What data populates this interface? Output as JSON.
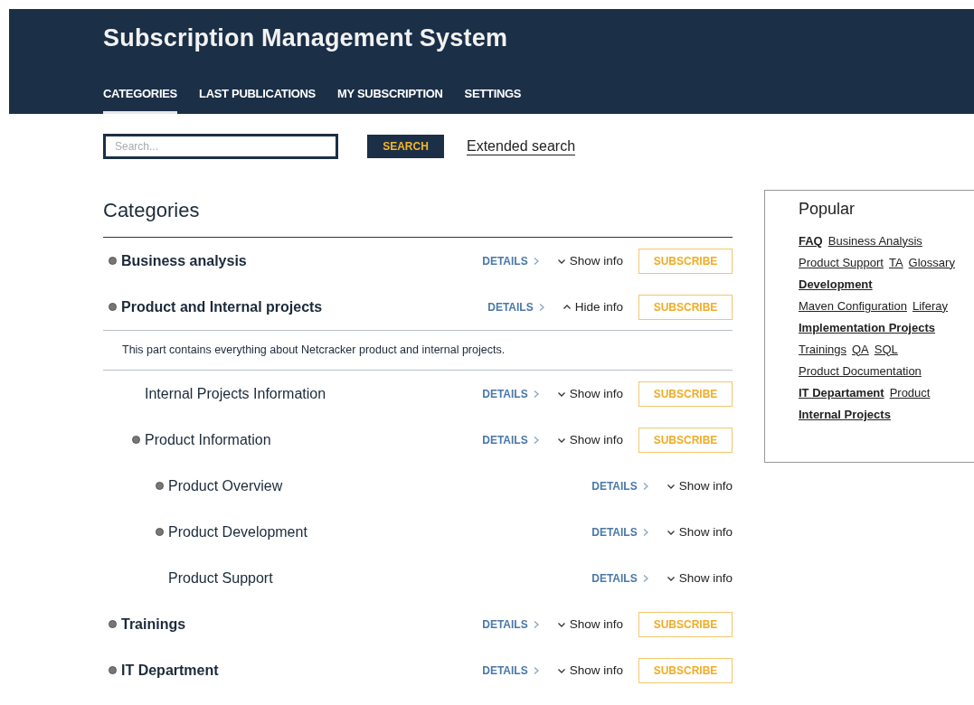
{
  "header": {
    "title": "Subscription Management System"
  },
  "nav": [
    {
      "label": "CATEGORIES",
      "selected": true
    },
    {
      "label": "LAST PUBLICATIONS",
      "selected": false
    },
    {
      "label": "MY SUBSCRIPTION",
      "selected": false
    },
    {
      "label": "SETTINGS",
      "selected": false
    }
  ],
  "search": {
    "placeholder": "Search...",
    "button": "SEARCH",
    "extended_link": "Extended search"
  },
  "categories": {
    "title": "Categories",
    "items": [
      {
        "name": "Business analysis",
        "has_subcategories": true,
        "details": "DETAILS",
        "toggle": "Show info",
        "expanded": false,
        "subscribe": "SUBSCRIBE"
      },
      {
        "name": "Product and Internal projects",
        "has_subcategories": true,
        "details": "DETAILS",
        "toggle": "Hide info",
        "expanded": true,
        "subscribe": "SUBSCRIBE",
        "description": "This part contains everything about Netcracker product and internal projects.",
        "children": [
          {
            "name": "Internal Projects Information",
            "has_subcategories": false,
            "details": "DETAILS",
            "toggle": "Show info",
            "expanded": false,
            "subscribe": "SUBSCRIBE"
          },
          {
            "name": "Product Information",
            "has_subcategories": true,
            "details": "DETAILS",
            "toggle": "Show info",
            "expanded": false,
            "subscribe": "SUBSCRIBE",
            "children": [
              {
                "name": "Product Overview",
                "has_subcategories": true,
                "details": "DETAILS",
                "toggle": "Show info",
                "expanded": false
              },
              {
                "name": "Product Development",
                "has_subcategories": true,
                "details": "DETAILS",
                "toggle": "Show info",
                "expanded": false
              },
              {
                "name": "Product Support",
                "has_subcategories": false,
                "details": "DETAILS",
                "toggle": "Show info",
                "expanded": false
              }
            ]
          }
        ]
      },
      {
        "name": "Trainings",
        "has_subcategories": true,
        "details": "DETAILS",
        "toggle": "Show info",
        "expanded": false,
        "subscribe": "SUBSCRIBE"
      },
      {
        "name": "IT Department",
        "has_subcategories": true,
        "details": "DETAILS",
        "toggle": "Show info",
        "expanded": false,
        "subscribe": "SUBSCRIBE"
      }
    ]
  },
  "popular": {
    "title": "Popular",
    "tags": [
      {
        "label": "FAQ",
        "bold": true
      },
      {
        "label": "Business Analysis",
        "bold": false
      },
      {
        "label": "Product Support",
        "bold": false
      },
      {
        "label": "TA",
        "bold": false
      },
      {
        "label": "Glossary",
        "bold": false
      },
      {
        "label": "Development",
        "bold": true
      },
      {
        "label": "Maven Configuration",
        "bold": false
      },
      {
        "label": "Liferay",
        "bold": false
      },
      {
        "label": "Implementation Projects",
        "bold": true
      },
      {
        "label": "Trainings",
        "bold": false
      },
      {
        "label": "QA",
        "bold": false
      },
      {
        "label": "SQL",
        "bold": false
      },
      {
        "label": "Product Documentation",
        "bold": false
      },
      {
        "label": "IT Departament",
        "bold": true
      },
      {
        "label": "Product",
        "bold": false
      },
      {
        "label": "Internal Projects",
        "bold": true
      }
    ]
  }
}
